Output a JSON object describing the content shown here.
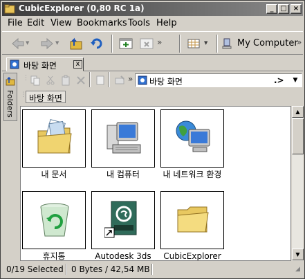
{
  "window": {
    "title": "CubicExplorer (0,80 RC 1a)"
  },
  "menu": [
    "File",
    "Edit",
    "View",
    "Bookmarks",
    "Tools",
    "Help"
  ],
  "toolbar": {
    "location_label": "My Computer"
  },
  "tab": {
    "label": "바탕 화면",
    "close": "x"
  },
  "sidebar": {
    "label": "Folders"
  },
  "address": {
    "value": "바탕 화면",
    "go": ".>"
  },
  "breadcrumb": {
    "label": "바탕 화면"
  },
  "items": [
    {
      "label": "내 문서",
      "icon": "my-documents-icon"
    },
    {
      "label": "내 컴퓨터",
      "icon": "my-computer-icon"
    },
    {
      "label": "내 네트워크 환경",
      "icon": "network-icon"
    },
    {
      "label": "휴지통",
      "icon": "recycle-bin-icon"
    },
    {
      "label": "Autodesk 3ds",
      "icon": "autodesk-icon"
    },
    {
      "label": "CubicExplorer",
      "icon": "folder-icon"
    }
  ],
  "status": {
    "selected": "0/19 Selected",
    "size": "0 Bytes / 42,54 MB"
  },
  "colors": {
    "titlebar_start": "#3c3c3c",
    "titlebar_end": "#8a8a8a",
    "face": "#d4d0c8"
  }
}
